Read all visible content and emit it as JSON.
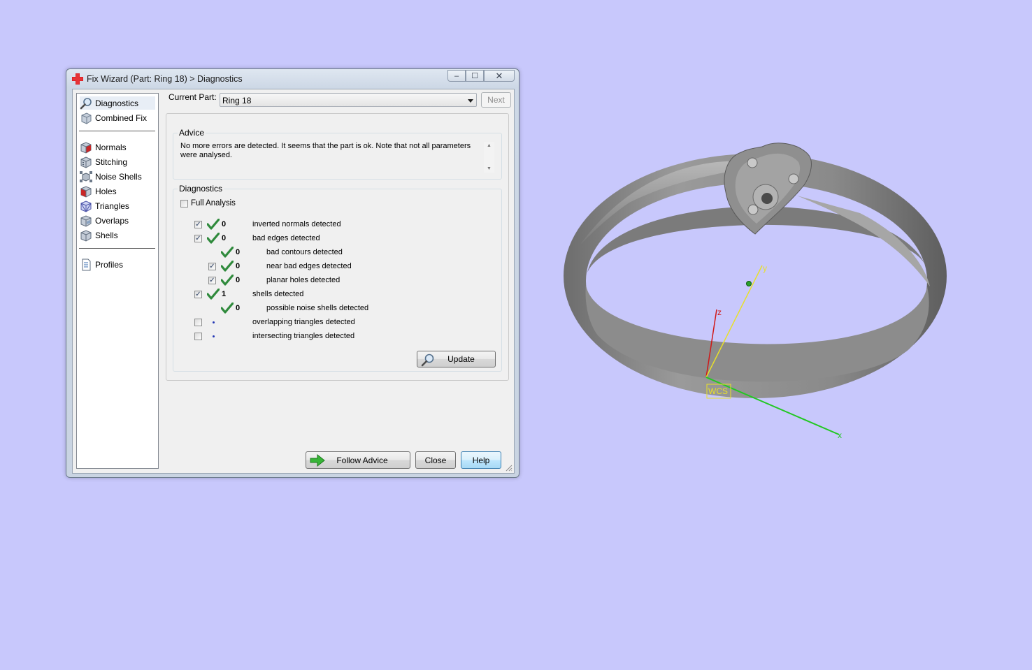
{
  "window": {
    "title": "Fix Wizard (Part: Ring 18) > Diagnostics",
    "buttons": {
      "minimize": "–",
      "maximize": "☐",
      "close": "✕"
    }
  },
  "nav": {
    "top_items": [
      {
        "label": "Diagnostics",
        "icon": "magnifier-icon",
        "selected": true
      },
      {
        "label": "Combined Fix",
        "icon": "cube-icon"
      }
    ],
    "fix_items": [
      {
        "label": "Normals",
        "icon": "normals-cube-icon"
      },
      {
        "label": "Stitching",
        "icon": "stitching-cube-icon"
      },
      {
        "label": "Noise Shells",
        "icon": "noise-shells-icon"
      },
      {
        "label": "Holes",
        "icon": "holes-cube-icon"
      },
      {
        "label": "Triangles",
        "icon": "triangles-cube-icon"
      },
      {
        "label": "Overlaps",
        "icon": "overlaps-cube-icon"
      },
      {
        "label": "Shells",
        "icon": "shells-cube-icon"
      }
    ],
    "bottom_items": [
      {
        "label": "Profiles",
        "icon": "document-icon"
      }
    ]
  },
  "current_part": {
    "label": "Current Part:",
    "value": "Ring 18",
    "next_button": "Next"
  },
  "advice": {
    "title": "Advice",
    "text": "No more errors are detected. It seems that the part is ok. Note that not all parameters were analysed."
  },
  "diagnostics": {
    "title": "Diagnostics",
    "full_analysis_label": "Full Analysis",
    "full_analysis_checked": false,
    "rows": [
      {
        "label": "inverted normals detected",
        "count": "0",
        "checked": true,
        "status": "ok",
        "indent": 0,
        "has_checkbox": true
      },
      {
        "label": "bad edges detected",
        "count": "0",
        "checked": true,
        "status": "ok",
        "indent": 0,
        "has_checkbox": true
      },
      {
        "label": "bad contours detected",
        "count": "0",
        "checked": false,
        "status": "ok",
        "indent": 1,
        "has_checkbox": false
      },
      {
        "label": "near bad edges detected",
        "count": "0",
        "checked": true,
        "status": "ok",
        "indent": 1,
        "has_checkbox": true
      },
      {
        "label": "planar holes detected",
        "count": "0",
        "checked": true,
        "status": "ok",
        "indent": 1,
        "has_checkbox": true
      },
      {
        "label": "shells detected",
        "count": "1",
        "checked": true,
        "status": "ok",
        "indent": 0,
        "has_checkbox": true
      },
      {
        "label": "possible noise shells detected",
        "count": "0",
        "checked": false,
        "status": "ok",
        "indent": 1,
        "has_checkbox": false
      },
      {
        "label": "overlapping triangles detected",
        "count": "",
        "checked": false,
        "status": "not-analysed",
        "indent": 0,
        "has_checkbox": true
      },
      {
        "label": "intersecting triangles detected",
        "count": "",
        "checked": false,
        "status": "not-analysed",
        "indent": 0,
        "has_checkbox": true
      }
    ],
    "update_button": "Update"
  },
  "footer": {
    "follow_advice": "Follow Advice",
    "close": "Close",
    "help": "Help"
  },
  "viewport": {
    "axis_labels": {
      "x": "x",
      "y": "y",
      "z": "z"
    },
    "wcs_label": "WCS",
    "colors": {
      "background": "#c8c8fc",
      "x_axis": "#22c822",
      "y_axis": "#e8e02a",
      "z_axis": "#d01818",
      "ring": "#8e8e8e"
    }
  }
}
